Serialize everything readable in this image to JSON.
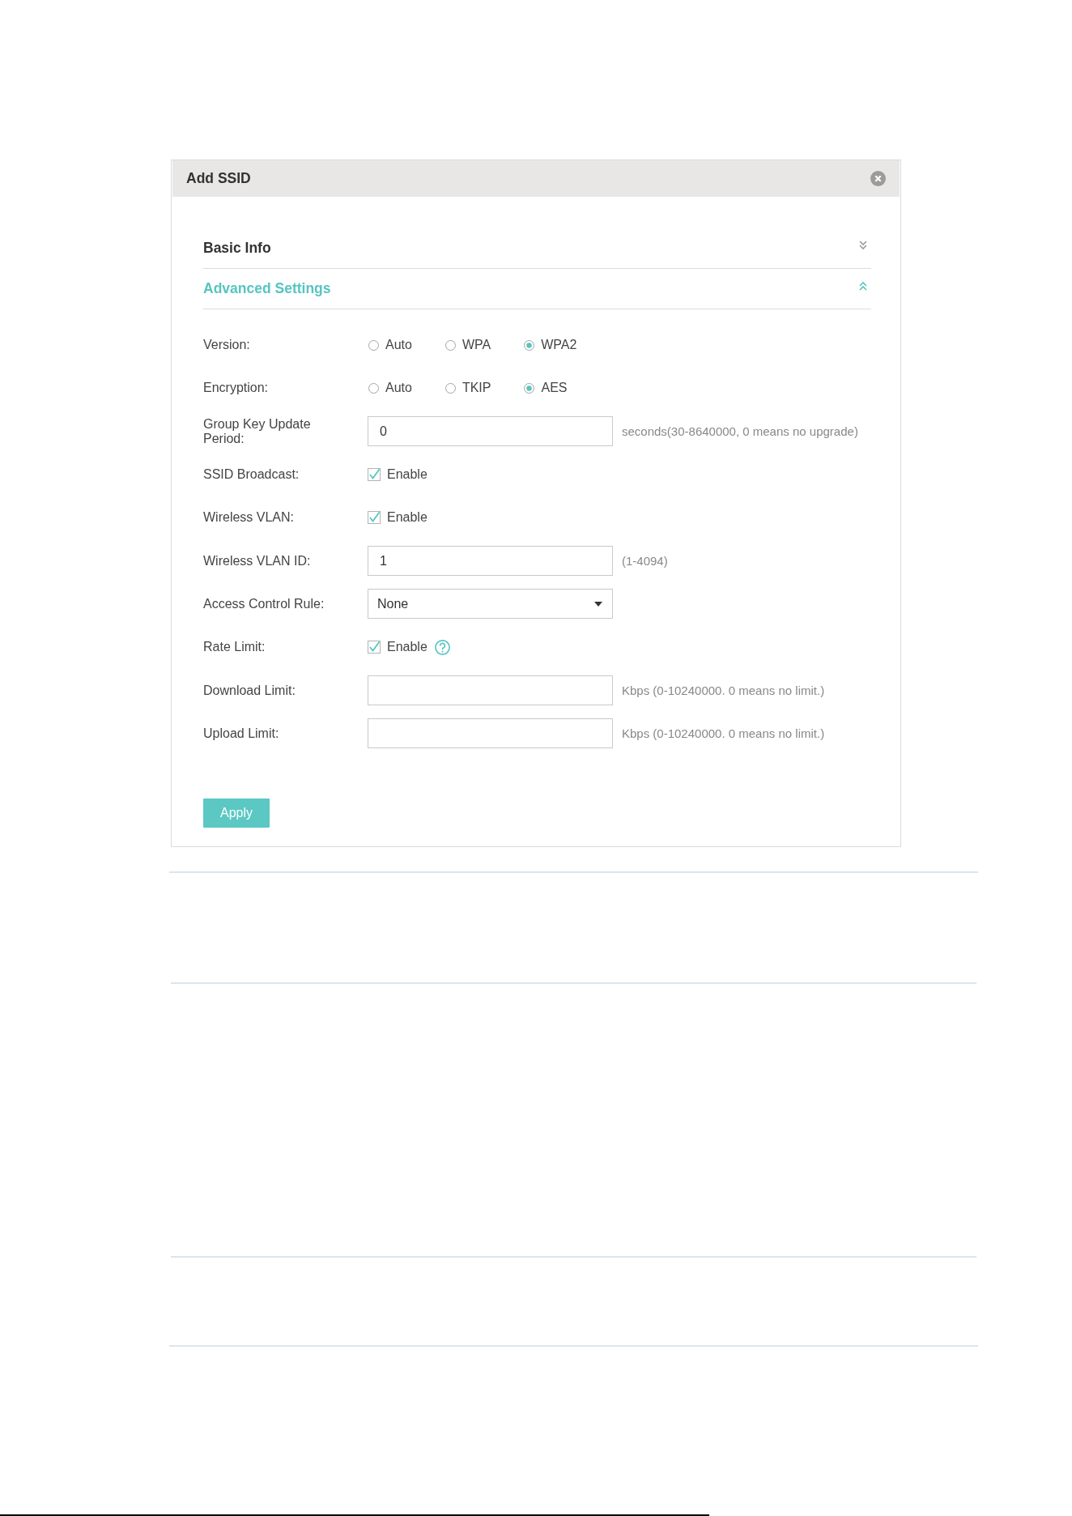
{
  "dialog": {
    "title": "Add SSID"
  },
  "sections": [
    {
      "title": "Basic Info",
      "expanded": false
    },
    {
      "title": "Advanced Settings",
      "expanded": true
    }
  ],
  "form": [
    {
      "kind": "radio",
      "label": "Version:",
      "options": [
        {
          "label": "Auto",
          "selected": false
        },
        {
          "label": "WPA",
          "selected": false
        },
        {
          "label": "WPA2",
          "selected": true
        }
      ]
    },
    {
      "kind": "radio",
      "label": "Encryption:",
      "options": [
        {
          "label": "Auto",
          "selected": false
        },
        {
          "label": "TKIP",
          "selected": false
        },
        {
          "label": "AES",
          "selected": true
        }
      ]
    },
    {
      "kind": "input",
      "label": "Group Key Update Period:",
      "value": "0",
      "hint": "seconds(30-8640000, 0 means no upgrade)"
    },
    {
      "kind": "checkbox",
      "label": "SSID Broadcast:",
      "option": "Enable",
      "checked": true
    },
    {
      "kind": "checkbox",
      "label": "Wireless VLAN:",
      "option": "Enable",
      "checked": true
    },
    {
      "kind": "input",
      "label": "Wireless VLAN ID:",
      "value": "1",
      "hint": "(1-4094)"
    },
    {
      "kind": "select",
      "label": "Access Control Rule:",
      "value": "None"
    },
    {
      "kind": "checkbox",
      "label": "Rate Limit:",
      "option": "Enable",
      "checked": true,
      "help": true
    },
    {
      "kind": "input",
      "label": "Download Limit:",
      "hint": "Kbps (0-10240000. 0 means no limit.)"
    },
    {
      "kind": "input",
      "label": "Upload Limit:",
      "hint": "Kbps (0-10240000. 0 means no limit.)"
    }
  ],
  "apply_button": "Apply"
}
